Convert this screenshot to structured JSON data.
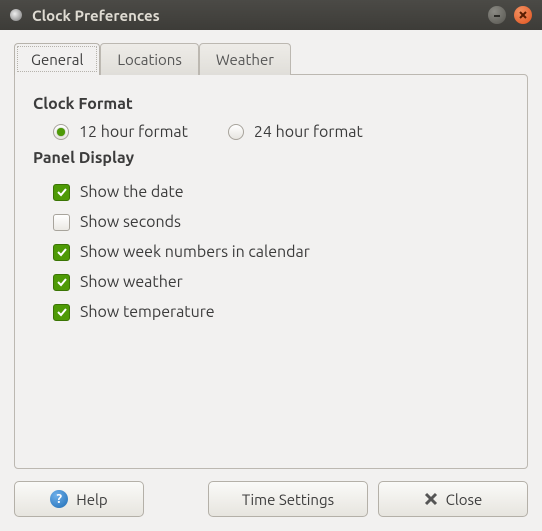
{
  "window": {
    "title": "Clock Preferences"
  },
  "tabs": {
    "general": "General",
    "locations": "Locations",
    "weather": "Weather",
    "active": "general"
  },
  "sections": {
    "clock_format": {
      "heading": "Clock Format",
      "opt12": "12 hour format",
      "opt24": "24 hour format",
      "selected": "12"
    },
    "panel_display": {
      "heading": "Panel Display",
      "items": [
        {
          "label": "Show the date",
          "checked": true
        },
        {
          "label": "Show seconds",
          "checked": false
        },
        {
          "label": "Show week numbers in calendar",
          "checked": true
        },
        {
          "label": "Show weather",
          "checked": true
        },
        {
          "label": "Show temperature",
          "checked": true
        }
      ]
    }
  },
  "buttons": {
    "help": "Help",
    "time_settings": "Time Settings",
    "close": "Close"
  }
}
